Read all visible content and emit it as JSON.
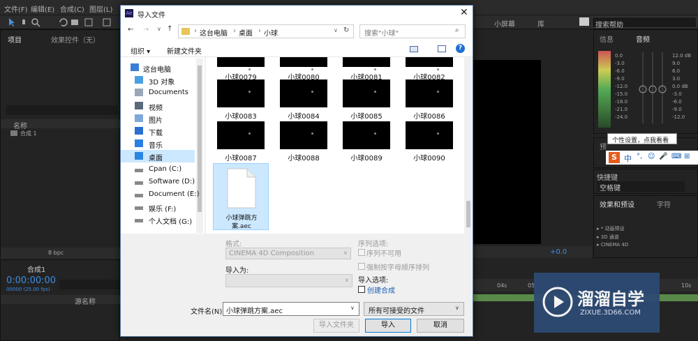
{
  "app": {
    "menu": [
      "文件(F)",
      "编辑(E)",
      "合成(C)",
      "图层(L)"
    ],
    "right_tabs": [
      "小屏幕",
      "库"
    ],
    "search_help": "搜索帮助"
  },
  "project_panel": {
    "tab1": "项目",
    "tab2": "效果控件（无）",
    "col_name": "名称",
    "item": "合成 1",
    "bpc": "8 bpc"
  },
  "timeline": {
    "tab": "合成1",
    "time": "0:00:00:00",
    "fps": "00000 (25.00 fps)",
    "col_source": "源名称"
  },
  "info_panel": {
    "tab_info": "信息",
    "tab_audio": "音频",
    "db_left": [
      "0.0",
      "-3.0",
      "-6.0",
      "-9.0",
      "-12.0",
      "-15.0",
      "-18.0",
      "-21.0",
      "-24.0"
    ],
    "db_right": [
      "12.0 dB",
      "9.0",
      "6.0",
      "3.0",
      "0.0 dB",
      "-3.0",
      "-6.0",
      "-9.0",
      "-12.0"
    ]
  },
  "tooltip": "个性设置，点我看看",
  "ime": {
    "brand": "S",
    "items": [
      "中",
      "°,",
      "☺",
      "🎤",
      "⌨",
      "👕",
      "⊞"
    ]
  },
  "preview_panel": {
    "tab": "预",
    "shortcut_label": "快捷键",
    "shortcut_value": "空格键"
  },
  "effects_panel": {
    "tab1": "效果和预设",
    "tab2": "字符",
    "items": [
      "▸ * 动画预设",
      "▸ 3D 通道",
      "▸ CINEMA 4D"
    ]
  },
  "comp_controls": {
    "value": "+0.0",
    "ruler": [
      "04s",
      "05",
      "10s"
    ]
  },
  "watermark": {
    "title": "溜溜自学",
    "url": "ZIXUE.3D66.COM"
  },
  "dialog": {
    "title": "导入文件",
    "path": [
      "这台电脑",
      "桌面",
      "小球"
    ],
    "search_placeholder": "搜索\"小球\"",
    "organize": "组织 ▾",
    "new_folder": "新建文件夹",
    "nav": [
      "这台电脑",
      "3D 对象",
      "Documents",
      "视频",
      "图片",
      "下载",
      "音乐",
      "桌面",
      "Cpan (C:)",
      "Software (D:)",
      "Document (E:)",
      "娱乐 (F:)",
      "个人文档 (G:)"
    ],
    "files_row1": [
      "小球0079",
      "小球0080",
      "小球0081",
      "小球0082"
    ],
    "files_row2": [
      "小球0083",
      "小球0084",
      "小球0085",
      "小球0086"
    ],
    "files_row3": [
      "小球0087",
      "小球0088",
      "小球0089",
      "小球0090"
    ],
    "aec_file": "小球弹跳方案.aec",
    "format_label": "格式:",
    "format_value": "CINEMA 4D Composition",
    "import_as_label": "导入为:",
    "sequence_label": "序列选项:",
    "seq_unavailable": "序列不可用",
    "force_alpha": "强制按字母顺序排列",
    "import_options_label": "导入选项:",
    "create_comp": "创建合成",
    "filename_label": "文件名(N):",
    "filename_value": "小球弹跳方案.aec",
    "filetype_value": "所有可接受的文件",
    "import_folder_btn": "导入文件夹",
    "import_btn": "导入",
    "cancel_btn": "取消"
  }
}
